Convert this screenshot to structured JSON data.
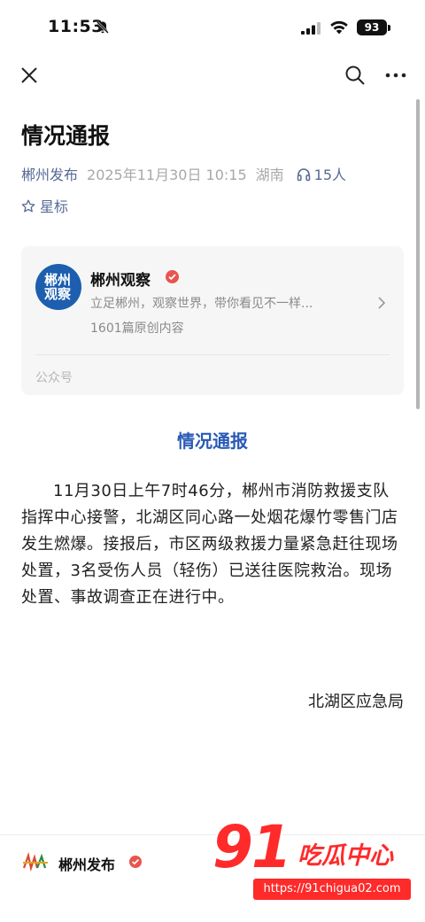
{
  "status_bar": {
    "time": "11:53",
    "battery": "93"
  },
  "article": {
    "title": "情况通报",
    "account": "郴州发布",
    "date": "2025年11月30日 10:15",
    "region": "湖南",
    "listeners": "15人",
    "star_label": "星标"
  },
  "account_card": {
    "avatar_text": [
      "郴州",
      "观察"
    ],
    "name": "郴州观察",
    "description": "立足郴州，观察世界，带你看见不一样...",
    "original_count": "1601篇原创内容",
    "type": "公众号"
  },
  "content": {
    "heading": "情况通报",
    "paragraph": "11月30日上午7时46分，郴州市消防救援支队指挥中心接警，北湖区同心路一处烟花爆竹零售门店发生燃爆。接报后，市区两级救援力量紧急赶往现场处置，3名受伤人员（轻伤）已送往医院救治。现场处置、事故调查正在进行中。",
    "signature": "北湖区应急局"
  },
  "bottom_bar": {
    "account": "郴州发布"
  },
  "watermark": {
    "number": "91",
    "brand": "吃瓜中心",
    "url": "https://91chigua02.com"
  },
  "colors": {
    "link": "#576b95",
    "heading_blue": "#2a5bb5",
    "verified_red": "#e8554e",
    "watermark_red": "#ff2a2a"
  },
  "icons": [
    "bell-off-icon",
    "signal-icon",
    "wifi-icon",
    "battery-icon",
    "close-icon",
    "search-icon",
    "more-icon",
    "headphone-icon",
    "star-icon",
    "verified-icon",
    "chevron-right-icon"
  ]
}
